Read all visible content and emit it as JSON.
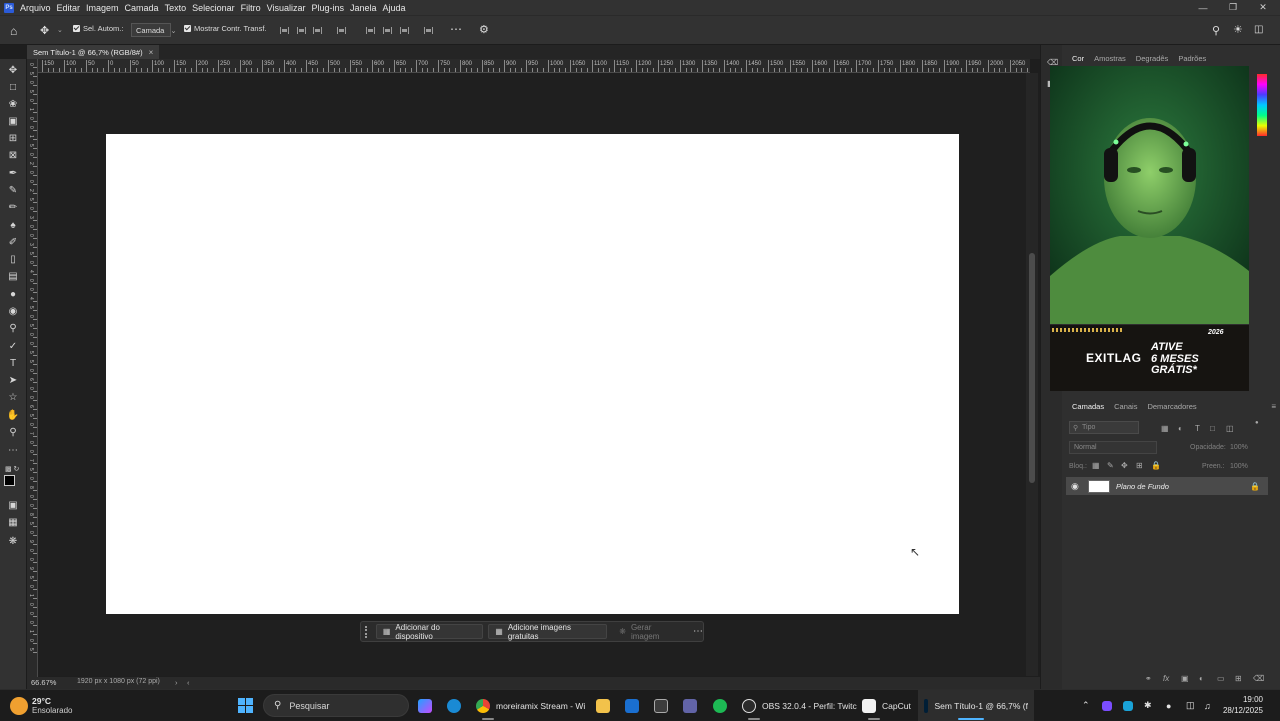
{
  "app": {
    "logo": "Ps"
  },
  "menu": [
    "Arquivo",
    "Editar",
    "Imagem",
    "Camada",
    "Texto",
    "Selecionar",
    "Filtro",
    "Visualizar",
    "Plug-ins",
    "Janela",
    "Ajuda"
  ],
  "options_bar": {
    "auto_select_label": "Sel. Autom.:",
    "auto_select_value": "Camada",
    "show_transform_label": "Mostrar Contr. Transf."
  },
  "document_tab": {
    "title": "Sem Título-1 @ 66,7% (RGB/8#)"
  },
  "ruler_top_labels": [
    "150",
    "100",
    "50",
    "0",
    "50",
    "100",
    "150",
    "200",
    "250",
    "300",
    "350",
    "400",
    "450",
    "500",
    "550",
    "600",
    "650",
    "700",
    "750",
    "800",
    "850",
    "900",
    "950",
    "1000",
    "1050",
    "1100",
    "1150",
    "1200",
    "1250",
    "1300",
    "1350",
    "1400",
    "1450",
    "1500",
    "1550",
    "1600",
    "1650",
    "1700",
    "1750",
    "1800",
    "1850",
    "1900",
    "1950",
    "2000",
    "2050"
  ],
  "ruler_left_labels": [
    "0",
    "5",
    "0",
    "5",
    "0",
    "1",
    "0",
    "0",
    "1",
    "5",
    "0",
    "2",
    "0",
    "0",
    "2",
    "5",
    "0",
    "3",
    "0",
    "0",
    "3",
    "5",
    "0",
    "4",
    "0",
    "0",
    "4",
    "5",
    "0",
    "5",
    "0",
    "0",
    "5",
    "5",
    "0",
    "6",
    "0",
    "0",
    "6",
    "5",
    "0",
    "7",
    "0",
    "0",
    "7",
    "5",
    "0",
    "8",
    "0",
    "0",
    "8",
    "5",
    "0",
    "9",
    "0",
    "0",
    "9",
    "5",
    "0",
    "1",
    "0",
    "0",
    "0",
    "1",
    "0",
    "5"
  ],
  "context_bar": {
    "add_from_device": "Adicionar do dispositivo",
    "add_free_images": "Adicione imagens gratuitas",
    "generate_image": "Gerar imagem"
  },
  "status": {
    "zoom": "66.67%",
    "doc_info": "1920 px x 1080 px (72 ppi)"
  },
  "color_panel_tabs": [
    "Cor",
    "Amostras",
    "Degradês",
    "Padrões"
  ],
  "ad": {
    "brand": "EXITLAG",
    "line1": "ATIVE",
    "line2": "6 MESES",
    "line3": "GRÁTIS*",
    "badge": "2026"
  },
  "layers_panel": {
    "tabs": [
      "Camadas",
      "Canais",
      "Demarcadores"
    ],
    "search_placeholder": "Tipo",
    "blend_mode": "Normal",
    "opacity_label": "Opacidade:",
    "opacity_value": "100%",
    "lock_label": "Bloq.:",
    "fill_label": "Preen.:",
    "fill_value": "100%",
    "layer_name": "Plano de Fundo"
  },
  "taskbar": {
    "weather_temp": "29°C",
    "weather_desc": "Ensolarado",
    "search": "Pesquisar",
    "items": [
      "moreiramix Stream - Wi",
      "OBS 32.0.4 - Perfil: Twitc",
      "CapCut",
      "Sem Título-1 @ 66,7% (f"
    ],
    "time": "19:00",
    "date": "28/12/2025"
  },
  "colors": {
    "accent": "#2b5bd8",
    "canvas": "#ffffff",
    "workspace": "#1f1f1f"
  }
}
